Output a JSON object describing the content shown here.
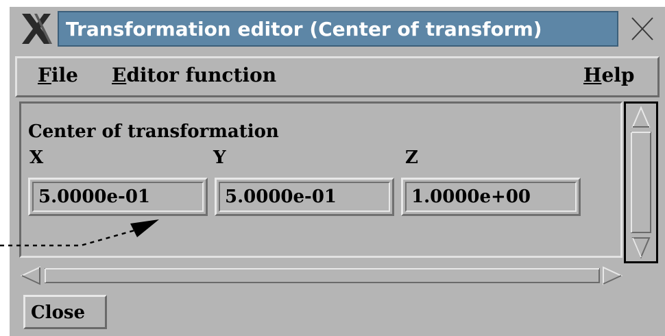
{
  "window": {
    "title": "Transformation editor (Center of transform)",
    "title_bar_color": "#5d86a6"
  },
  "menu": {
    "file": {
      "mnemonic": "F",
      "rest": "ile"
    },
    "editor_function": {
      "mnemonic": "E",
      "rest": "ditor function"
    },
    "help": {
      "mnemonic": "H",
      "rest": "elp"
    }
  },
  "panel": {
    "heading": "Center of transformation",
    "x_label": "X",
    "y_label": "Y",
    "z_label": "Z",
    "x_value": "5.0000e-01",
    "y_value": "5.0000e-01",
    "z_value": "1.0000e+00"
  },
  "buttons": {
    "close": "Close"
  },
  "icons": {
    "window_menu": "x-logo-icon",
    "window_close": "close-icon",
    "scroll_up": "arrow-up-icon",
    "scroll_down": "arrow-down-icon",
    "scroll_left": "arrow-left-icon",
    "scroll_right": "arrow-right-icon"
  }
}
